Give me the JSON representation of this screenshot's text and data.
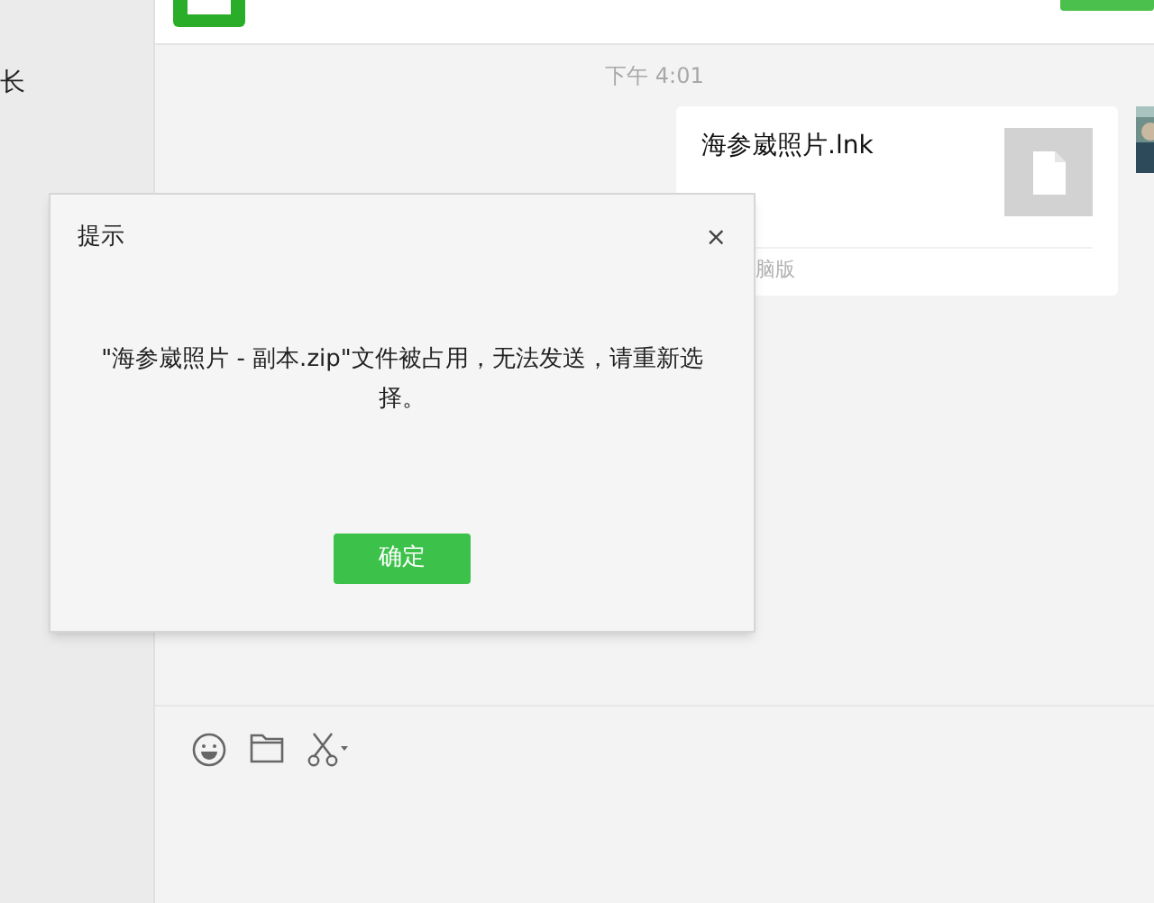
{
  "sidebar": {
    "items": [
      {
        "label": "长"
      }
    ]
  },
  "chat": {
    "timestamp": "下午 4:01",
    "messages": [
      {
        "kind": "file",
        "file_name": "海参崴照片.lnk",
        "source": "脑版"
      }
    ]
  },
  "input_toolbar": {
    "tools": [
      {
        "kind": "emoji"
      },
      {
        "kind": "folder"
      },
      {
        "kind": "scissors"
      }
    ]
  },
  "dialog": {
    "title": "提示",
    "close": "×",
    "message": "\"海参崴照片 - 副本.zip\"文件被占用，无法发送，请重新选择。",
    "button": "确定"
  }
}
